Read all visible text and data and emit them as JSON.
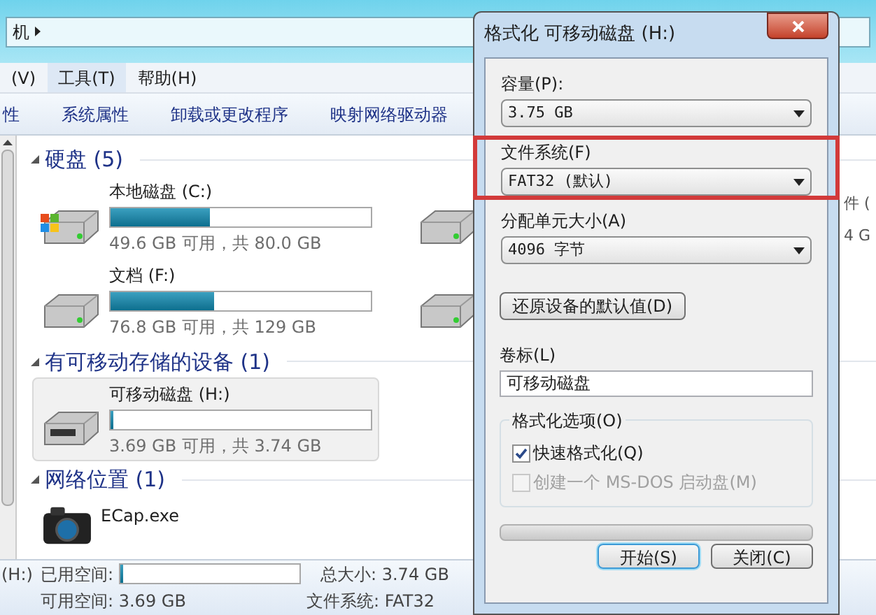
{
  "explorer": {
    "address": "机",
    "menu": [
      {
        "label": "(V)",
        "selected": false
      },
      {
        "label": "工具(T)",
        "selected": true
      },
      {
        "label": "帮助(H)",
        "selected": false
      }
    ],
    "toolbar": [
      "性",
      "系统属性",
      "卸载或更改程序",
      "映射网络驱动器"
    ],
    "groups": [
      {
        "title": "硬盘 (5)",
        "items": [
          {
            "kind": "system-drive",
            "name": "本地磁盘 (C:)",
            "level": 0.38,
            "info": "49.6 GB 可用，共 80.0 GB",
            "selected": false
          },
          {
            "kind": "drive",
            "name": "文档 (F:)",
            "level": 0.4,
            "info": "76.8 GB 可用，共 129 GB",
            "selected": false
          }
        ],
        "side_items": [
          {
            "kind": "drive",
            "fragments": [
              "件 (",
              "4 G"
            ]
          },
          {
            "kind": "drive"
          }
        ]
      },
      {
        "title": "有可移动存储的设备 (1)",
        "items": [
          {
            "kind": "removable",
            "name": "可移动磁盘 (H:)",
            "level": 0.013,
            "info": "3.69 GB 可用，共 3.74 GB",
            "selected": true
          }
        ]
      },
      {
        "title": "网络位置 (1)",
        "items": [
          {
            "kind": "camera",
            "name": "ECap.exe",
            "selected": false
          }
        ]
      }
    ],
    "status": {
      "drive": "(H:)",
      "used_label": "已用空间:",
      "used_bar": {
        "level": 0.013
      },
      "total": "总大小: 3.74 GB",
      "free": "可用空间: 3.69 GB",
      "fs": "文件系统: FAT32"
    }
  },
  "dialog": {
    "title": "格式化 可移动磁盘 (H:)",
    "fields": [
      {
        "label": "容量(P):",
        "value": "3.75 GB",
        "highlighted": false
      },
      {
        "label": "文件系统(F)",
        "value": "FAT32 (默认)",
        "highlighted": true
      },
      {
        "label": "分配单元大小(A)",
        "value": "4096 字节",
        "highlighted": false
      }
    ],
    "restore_button": "还原设备的默认值(D)",
    "volume_label": "卷标(L)",
    "volume_value": "可移动磁盘",
    "options_title": "格式化选项(O)",
    "options": [
      {
        "label": "快速格式化(Q)",
        "checked": true,
        "disabled": false
      },
      {
        "label": "创建一个 MS-DOS 启动盘(M)",
        "checked": false,
        "disabled": true
      }
    ],
    "progress": {
      "level": 0
    },
    "buttons": [
      {
        "label": "开始(S)",
        "default": true
      },
      {
        "label": "关闭(C)",
        "default": false
      }
    ]
  }
}
